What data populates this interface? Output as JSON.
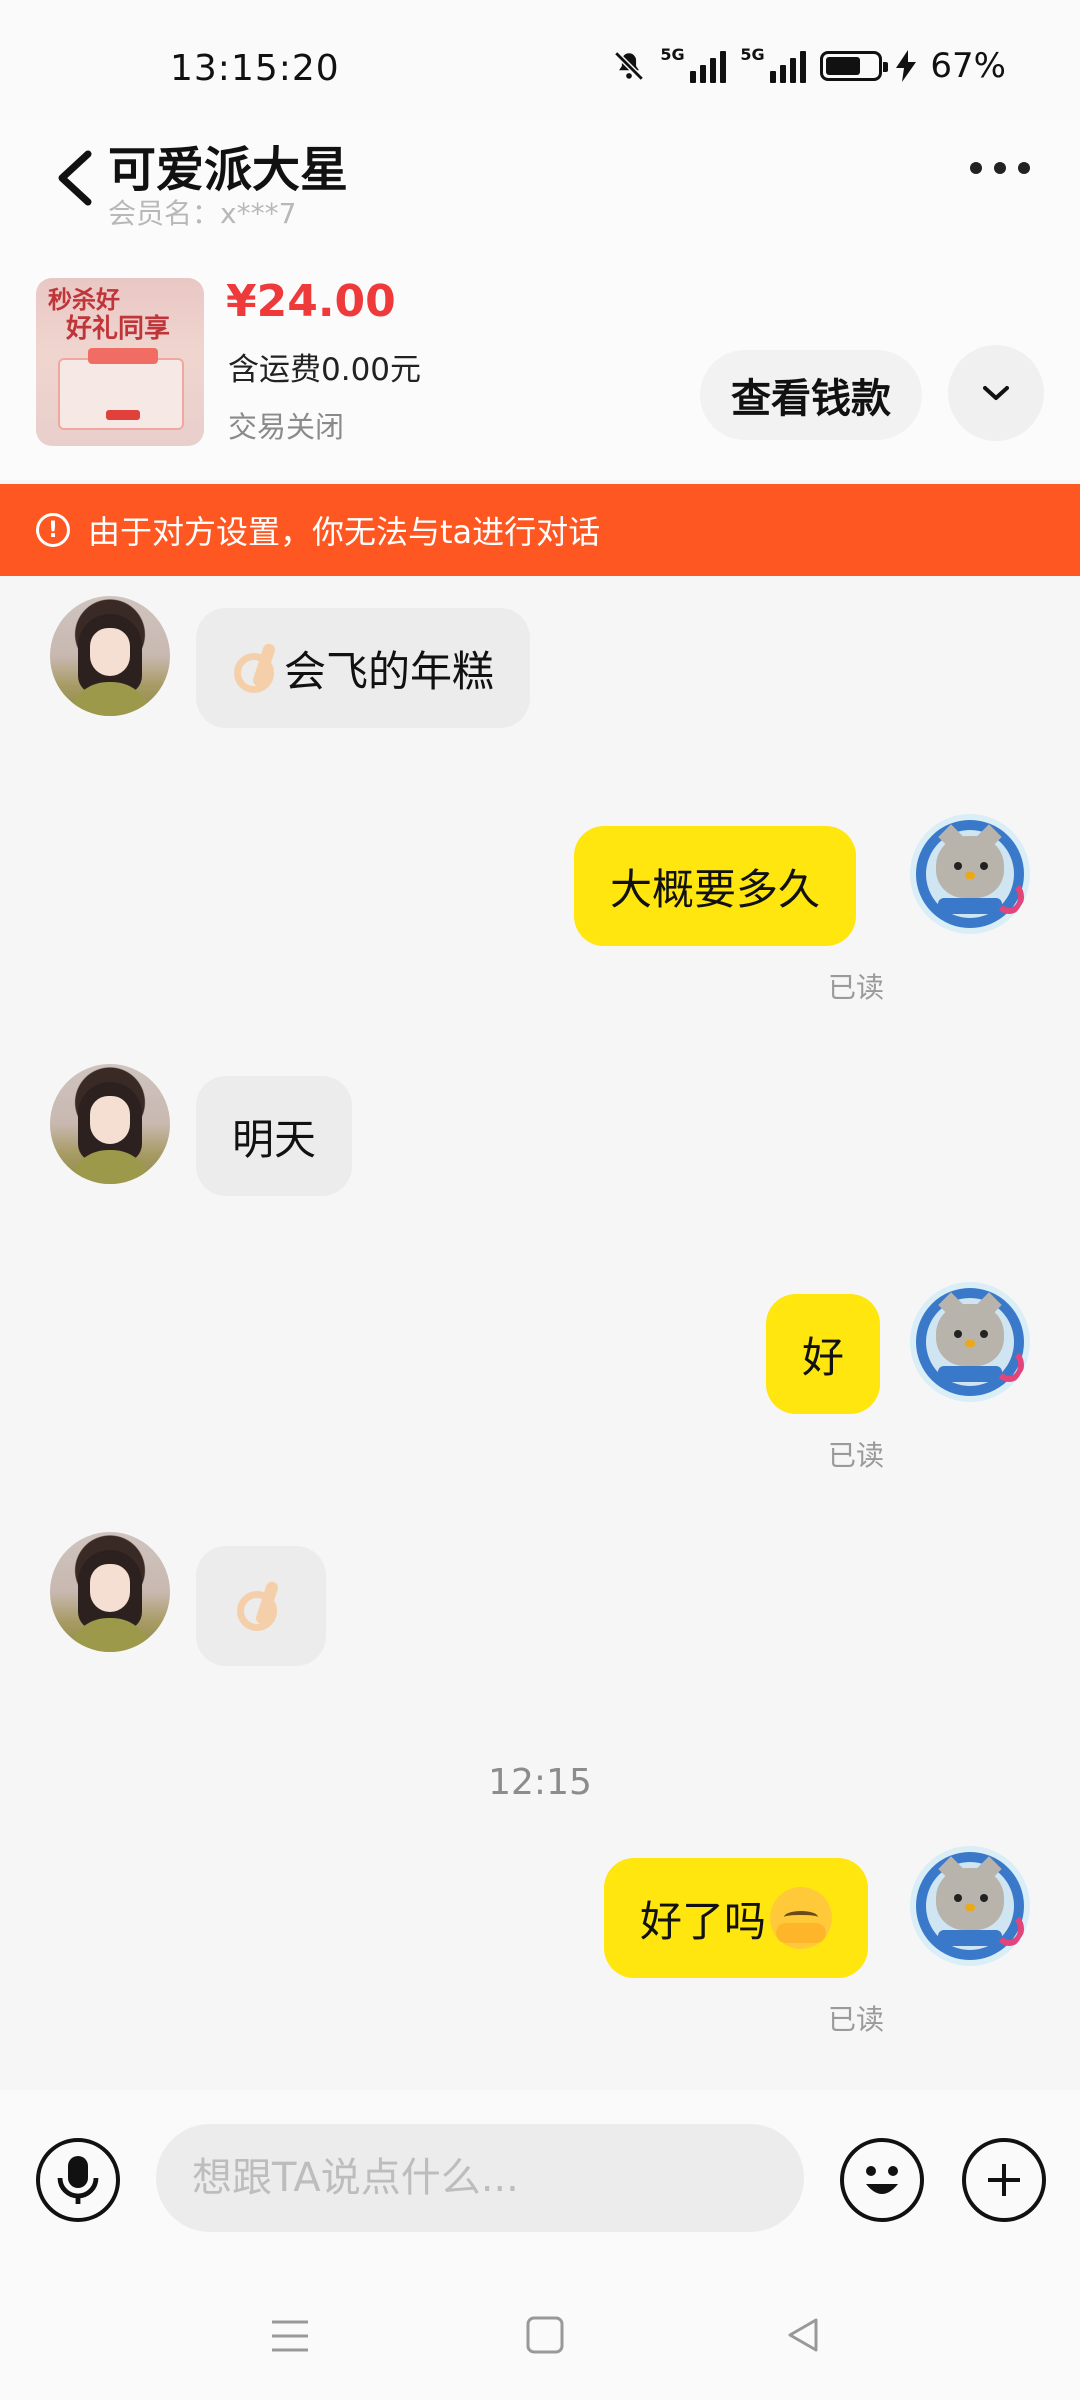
{
  "status_bar": {
    "time": "13:15:20",
    "network_1": "5G",
    "network_2": "5G",
    "battery_level": 0.67,
    "battery_text": "67%"
  },
  "header": {
    "title": "可爱派大星",
    "member_label": "会员名：x***7",
    "more_icon": "more-dots-icon",
    "back_icon": "back-chevron-icon"
  },
  "product": {
    "thumb_line1": "秒杀好",
    "thumb_line2": "好礼同享",
    "price": "¥24.00",
    "shipping": "含运费0.00元",
    "status": "交易关闭",
    "view_button": "查看钱款",
    "expand_icon": "chevron-down-icon"
  },
  "banner": {
    "text": "由于对方设置，你无法与ta进行对话",
    "icon": "warning-circle-icon",
    "color": "#ff5722"
  },
  "messages": [
    {
      "side": "left",
      "text": "会飞的年糕",
      "emoji": "ok-hand"
    },
    {
      "side": "right",
      "text": "大概要多久",
      "read": "已读"
    },
    {
      "side": "left",
      "text": "明天"
    },
    {
      "side": "right",
      "text": "好",
      "read": "已读"
    },
    {
      "side": "left",
      "text": "",
      "emoji": "ok-hand"
    },
    {
      "side": "right",
      "text": "好了吗",
      "emoji": "blush",
      "read": "已读"
    }
  ],
  "time_separator": "12:15",
  "input": {
    "placeholder": "想跟TA说点什么...",
    "mic_icon": "microphone-icon",
    "emoji_icon": "smiley-icon",
    "plus_icon": "plus-icon"
  },
  "colors": {
    "my_bubble": "#ffe60f",
    "their_bubble": "#ececec",
    "price": "#ee3a3a"
  }
}
